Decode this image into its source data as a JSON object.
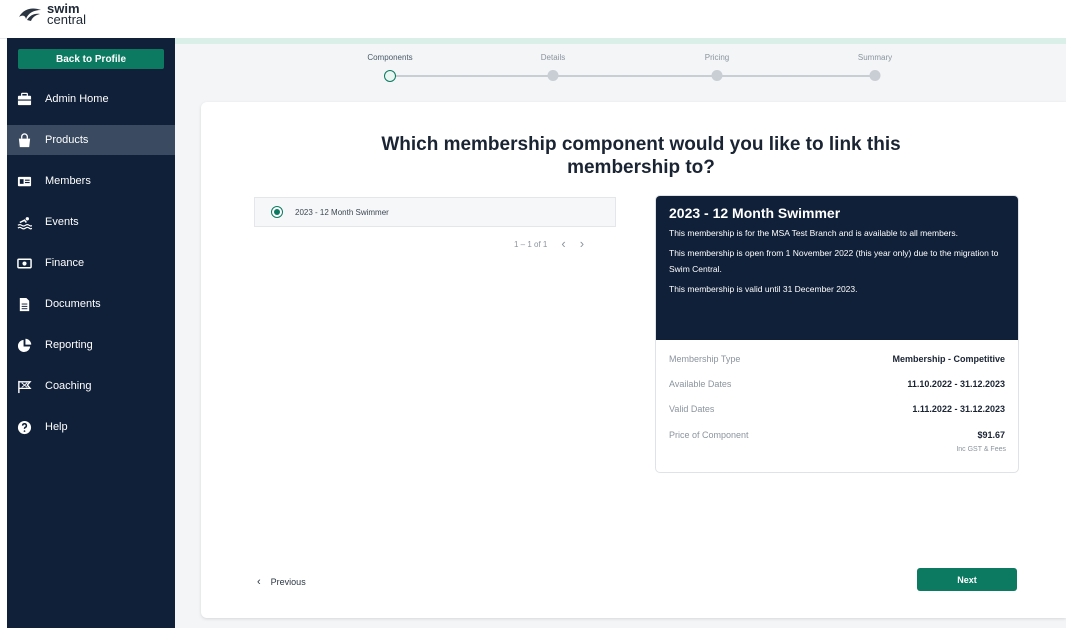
{
  "brand": {
    "logo_line1": "swim",
    "logo_line2": "central"
  },
  "sidebar": {
    "back_label": "Back to Profile",
    "items": [
      {
        "label": "Admin Home",
        "icon": "briefcase-icon"
      },
      {
        "label": "Products",
        "icon": "shopping-bag-icon",
        "active": true
      },
      {
        "label": "Members",
        "icon": "id-card-icon"
      },
      {
        "label": "Events",
        "icon": "swimmer-icon"
      },
      {
        "label": "Finance",
        "icon": "banknote-icon"
      },
      {
        "label": "Documents",
        "icon": "document-icon"
      },
      {
        "label": "Reporting",
        "icon": "pie-chart-icon"
      },
      {
        "label": "Coaching",
        "icon": "flag-icon"
      },
      {
        "label": "Help",
        "icon": "help-circle-icon"
      }
    ]
  },
  "stepper": {
    "steps": [
      "Components",
      "Details",
      "Pricing",
      "Summary"
    ],
    "current": "Components"
  },
  "main": {
    "question": "Which membership component would you like to link this membership to?",
    "option_label": "2023 - 12 Month Swimmer",
    "pager_text": "1 – 1 of 1",
    "prev_label": "Previous",
    "next_label": "Next"
  },
  "detail": {
    "title": "2023 - 12 Month Swimmer",
    "desc1": "This membership is for the MSA Test Branch and is available to all members.",
    "desc2": "This membership is open from 1 November 2022 (this year only) due to the migration to Swim Central.",
    "desc3": "This membership is valid until 31 December 2023.",
    "rows": [
      {
        "key": "Membership Type",
        "value": "Membership - Competitive"
      },
      {
        "key": "Available Dates",
        "value": "11.10.2022 - 31.12.2023"
      },
      {
        "key": "Valid Dates",
        "value": "1.11.2022 - 31.12.2023"
      },
      {
        "key": "Price of Component",
        "value": "$91.67"
      }
    ],
    "price_sub": "Inc GST & Fees"
  },
  "colors": {
    "sidebar_bg": "#102039",
    "accent_green": "#0c7a61",
    "active_item_bg": "#3a4a61"
  }
}
